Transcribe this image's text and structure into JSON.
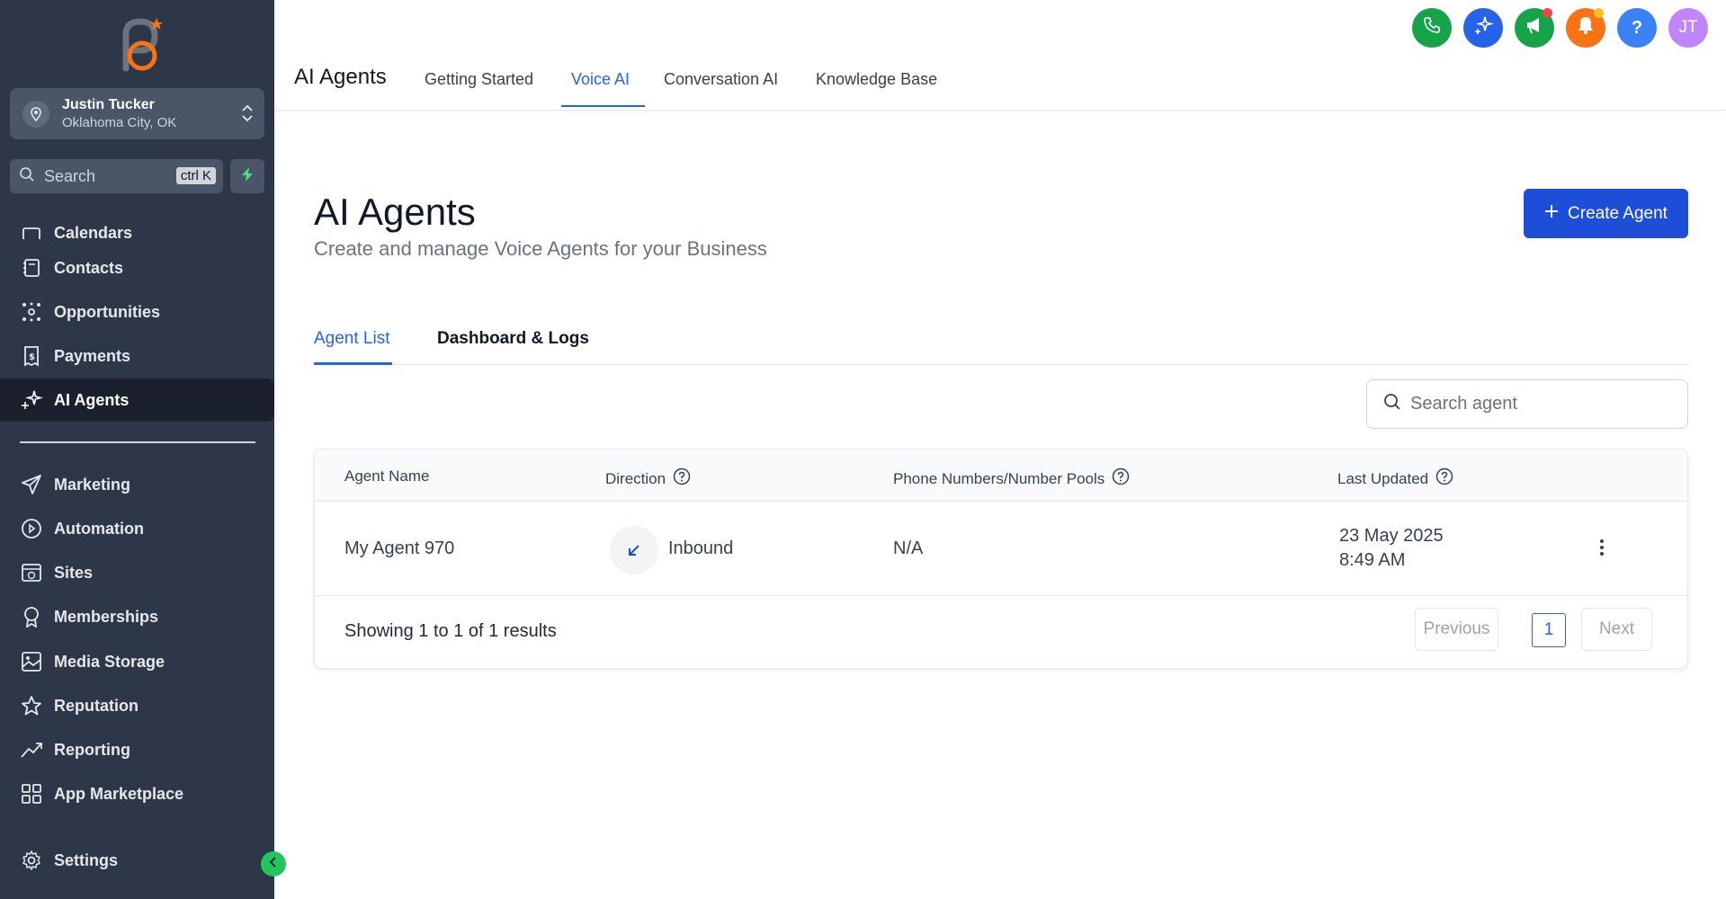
{
  "sidebar": {
    "account": {
      "name": "Justin Tucker",
      "location": "Oklahoma City, OK"
    },
    "search": {
      "label": "Search",
      "shortcut": "ctrl K"
    },
    "items": [
      {
        "label": "Calendars",
        "icon": "calendar-icon"
      },
      {
        "label": "Contacts",
        "icon": "contacts-icon"
      },
      {
        "label": "Opportunities",
        "icon": "opportunities-icon"
      },
      {
        "label": "Payments",
        "icon": "payments-icon"
      },
      {
        "label": "AI Agents",
        "icon": "sparkle-icon",
        "active": true
      },
      {
        "label": "Marketing",
        "icon": "send-icon"
      },
      {
        "label": "Automation",
        "icon": "automation-icon"
      },
      {
        "label": "Sites",
        "icon": "globe-icon"
      },
      {
        "label": "Memberships",
        "icon": "award-icon"
      },
      {
        "label": "Media Storage",
        "icon": "image-icon"
      },
      {
        "label": "Reputation",
        "icon": "star-icon"
      },
      {
        "label": "Reporting",
        "icon": "trend-icon"
      },
      {
        "label": "App Marketplace",
        "icon": "grid-icon"
      },
      {
        "label": "Settings",
        "icon": "gear-icon"
      }
    ]
  },
  "header": {
    "title": "AI Agents",
    "tabs": [
      {
        "label": "Getting Started"
      },
      {
        "label": "Voice AI",
        "active": true
      },
      {
        "label": "Conversation AI"
      },
      {
        "label": "Knowledge Base"
      }
    ],
    "avatar_initials": "JT",
    "help_glyph": "?",
    "colors": {
      "phone": "#16a34a",
      "ai": "#2563eb",
      "announce": "#16a34a",
      "notifications": "#f97316",
      "help": "#3b82f6",
      "avatar": "#c084fc"
    }
  },
  "main": {
    "title": "AI Agents",
    "subtitle": "Create and manage Voice Agents for your Business",
    "create_button": "Create Agent",
    "tabs": [
      {
        "label": "Agent List",
        "active": true
      },
      {
        "label": "Dashboard & Logs"
      }
    ],
    "search_placeholder": "Search agent",
    "table": {
      "columns": [
        "Agent Name",
        "Direction",
        "Phone Numbers/Number Pools",
        "Last Updated"
      ],
      "rows": [
        {
          "agent_name": "My Agent 970",
          "direction": "Inbound",
          "phone_numbers": "N/A",
          "last_updated_date": "23 May 2025",
          "last_updated_time": "8:49 AM"
        }
      ],
      "footer_text": "Showing 1 to 1 of 1 results",
      "pagination": {
        "previous": "Previous",
        "current_page": "1",
        "next": "Next"
      }
    }
  },
  "colors": {
    "sidebar_bg": "#2d3748",
    "accent": "#2563eb",
    "primary_button": "#1d4ed8"
  }
}
